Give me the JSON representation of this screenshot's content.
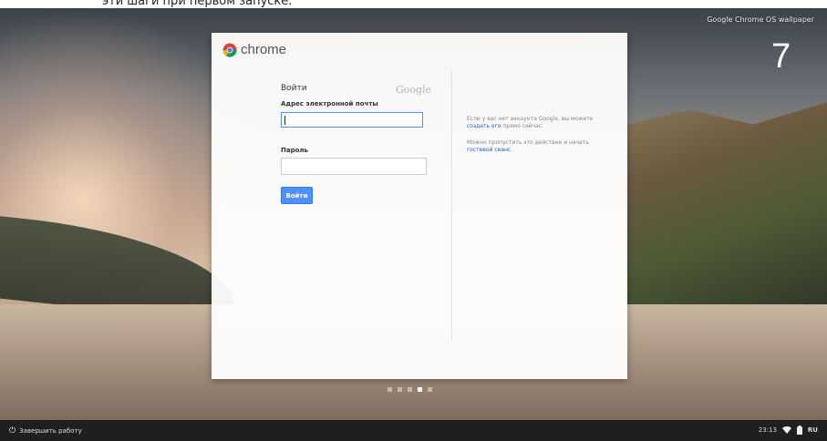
{
  "header": {
    "caption": "эти шаги при первом запуске."
  },
  "desktop": {
    "credit": "Google Chrome OS wallpaper",
    "step_number": "7"
  },
  "dialog": {
    "logo_text": "chrome",
    "title": "Войти",
    "google_mark": "Google",
    "email_label": "Адрес электронной почты",
    "email_value": "",
    "password_label": "Пароль",
    "password_value": "",
    "signin_button": "Войти",
    "info_paragraph1_text": "Если у вас нет аккаунта Google, вы можете ",
    "info_paragraph1_link": "создать его",
    "info_paragraph1_suffix": " прямо сейчас.",
    "info_paragraph2_text": "Можно пропустить это действие и начать ",
    "info_paragraph2_link": "гостевой сеанс",
    "info_paragraph2_suffix": "."
  },
  "pager": {
    "pages": 5,
    "active_index": 3
  },
  "shelf": {
    "shutdown_label": "Завершить работу",
    "time": "23:13",
    "language": "RU"
  },
  "icons": [
    "chrome-logo-icon",
    "power-icon",
    "wifi-icon",
    "battery-icon"
  ]
}
